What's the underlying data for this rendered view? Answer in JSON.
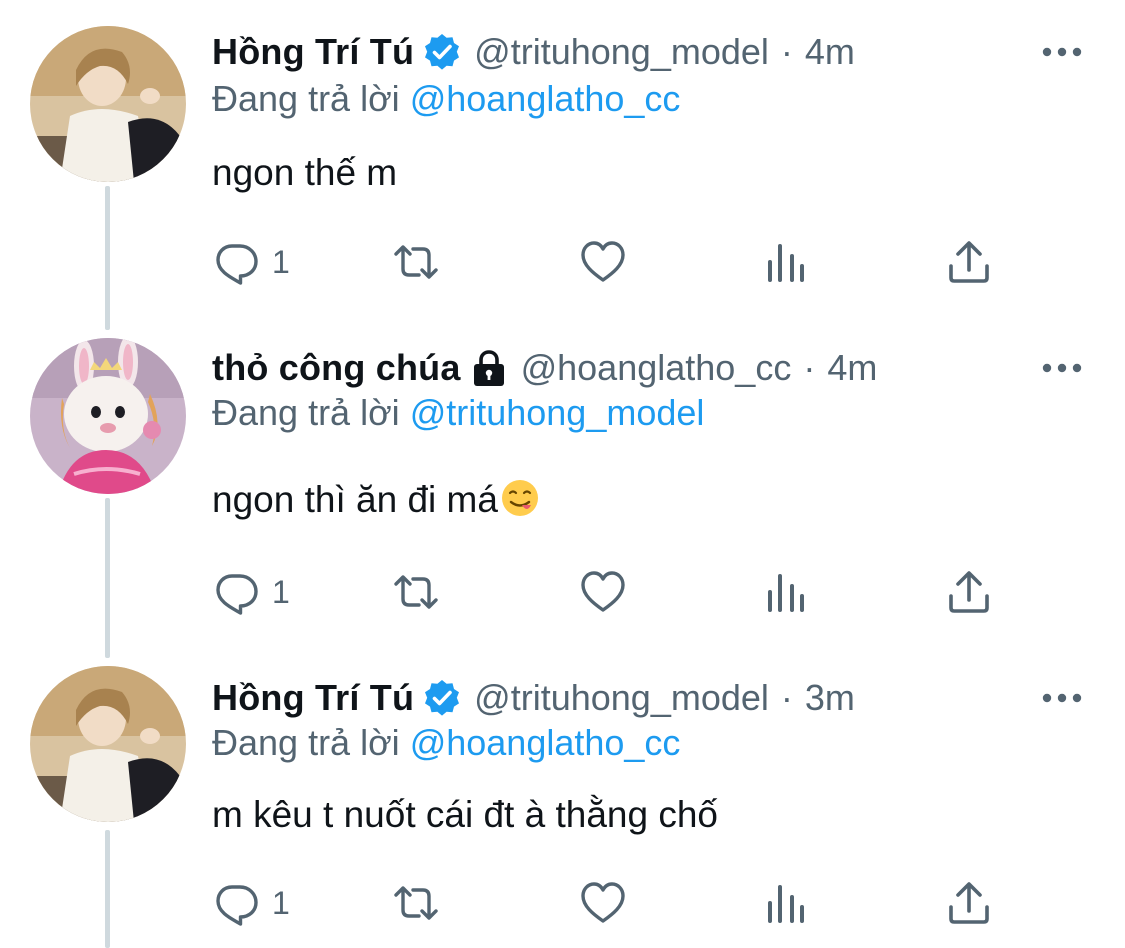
{
  "tweets": [
    {
      "display_name": "Hồng Trí Tú",
      "badge": "verified-badge-icon",
      "handle": "@trituhong_model",
      "separator": "·",
      "time": "4m",
      "reply_prefix": "Đang trả lời",
      "reply_to": "@hoanglatho_cc",
      "text": "ngon thế m",
      "reply_count": "1"
    },
    {
      "display_name": "thỏ công chúa",
      "badge": "lock-icon",
      "handle": "@hoanglatho_cc",
      "separator": "·",
      "time": "4m",
      "reply_prefix": "Đang trả lời",
      "reply_to": "@trituhong_model",
      "text": "ngon thì ăn đi má",
      "emoji": "yum-face-emoji",
      "reply_count": "1"
    },
    {
      "display_name": "Hồng Trí Tú",
      "badge": "verified-badge-icon",
      "handle": "@trituhong_model",
      "separator": "·",
      "time": "3m",
      "reply_prefix": "Đang trả lời",
      "reply_to": "@hoanglatho_cc",
      "text": "m kêu t nuốt cái đt à thằng chố",
      "reply_count": "1"
    }
  ],
  "action_icons": [
    "reply-icon",
    "retweet-icon",
    "like-icon",
    "analytics-icon",
    "share-icon"
  ],
  "colors": {
    "text": "#0f1419",
    "secondary": "#536471",
    "link": "#1d9bf0",
    "thread_line": "#cfd9de",
    "background": "#ffffff"
  }
}
